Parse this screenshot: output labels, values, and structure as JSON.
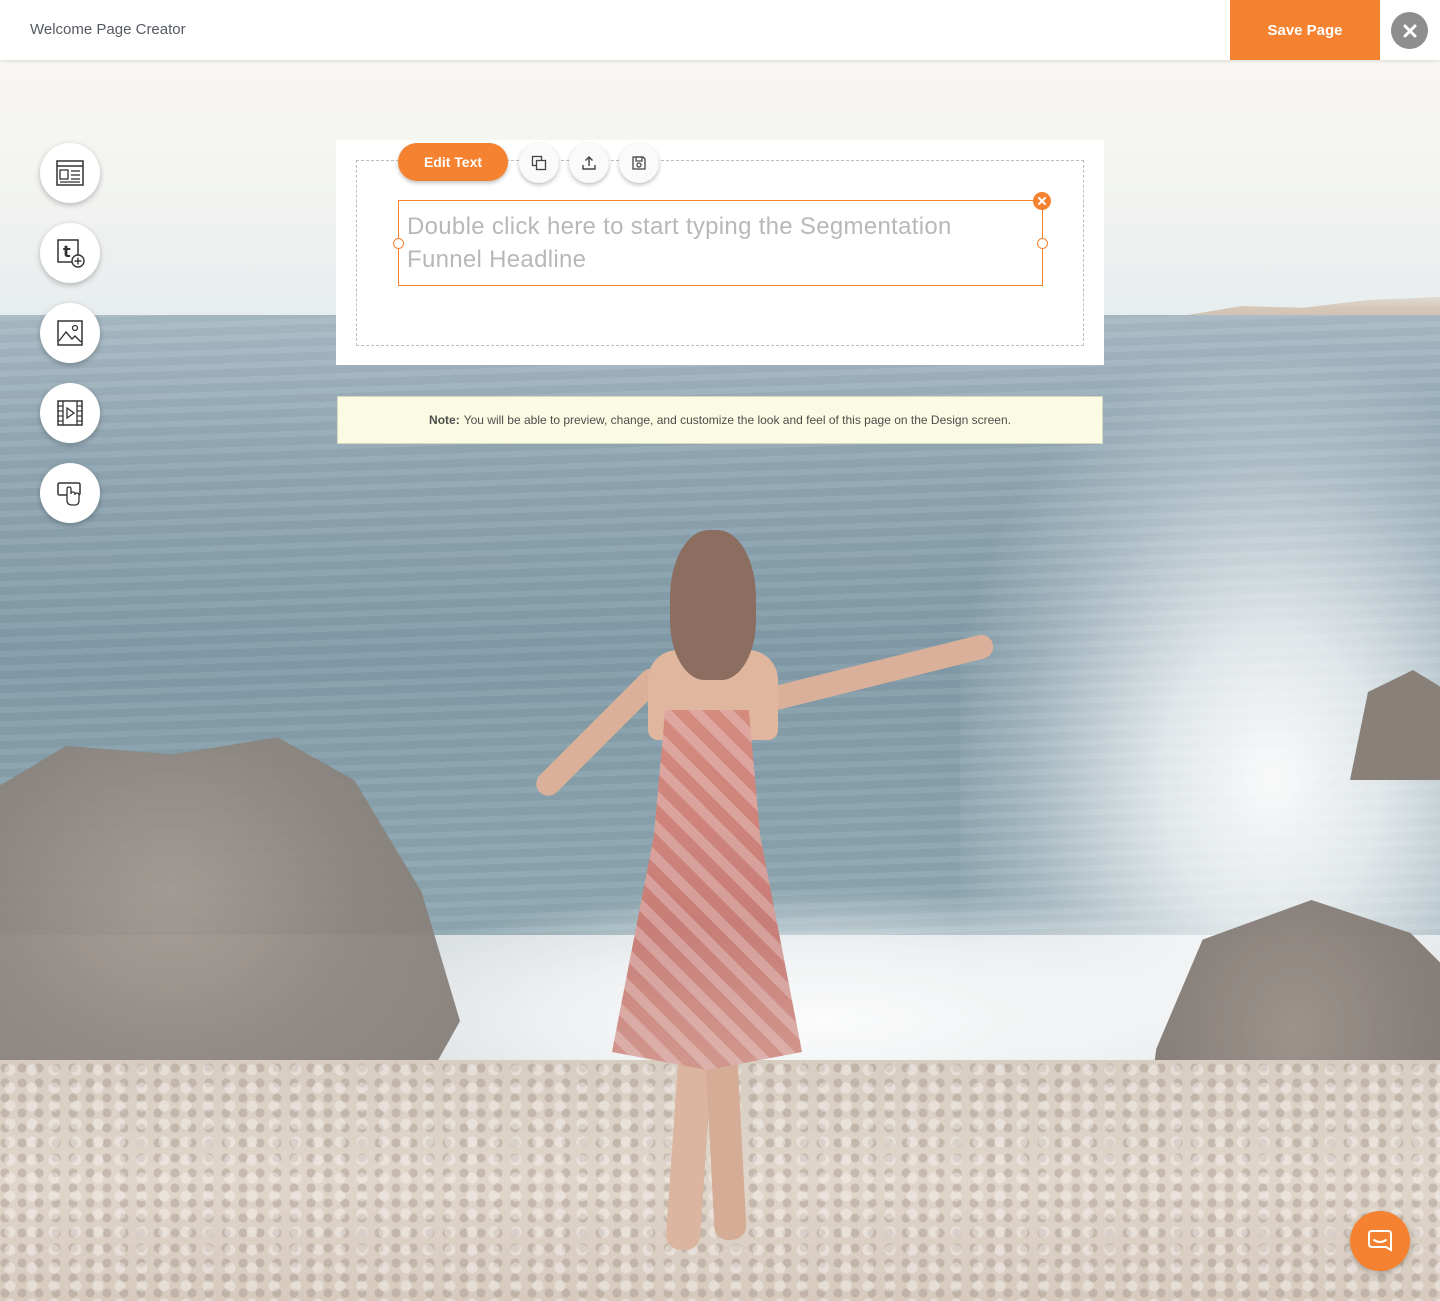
{
  "header": {
    "title": "Welcome Page Creator",
    "save_label": "Save Page",
    "close_icon": "close-icon"
  },
  "sidebar": {
    "tools": [
      {
        "name": "layout-block-icon"
      },
      {
        "name": "add-text-icon"
      },
      {
        "name": "image-icon"
      },
      {
        "name": "video-icon"
      },
      {
        "name": "button-click-icon"
      }
    ]
  },
  "editor": {
    "edit_text_label": "Edit Text",
    "toolbar_icons": [
      "duplicate-icon",
      "upload-icon",
      "save-icon"
    ],
    "headline_placeholder": "Double click here to start typing the Segmentation Funnel Headline"
  },
  "note": {
    "label": "Note:",
    "text": "You will be able to preview, change, and customize the look and feel of this page on the Design screen."
  },
  "colors": {
    "accent": "#f58230",
    "note_background": "#fafbe2",
    "placeholder_text": "#b8b8b8"
  }
}
